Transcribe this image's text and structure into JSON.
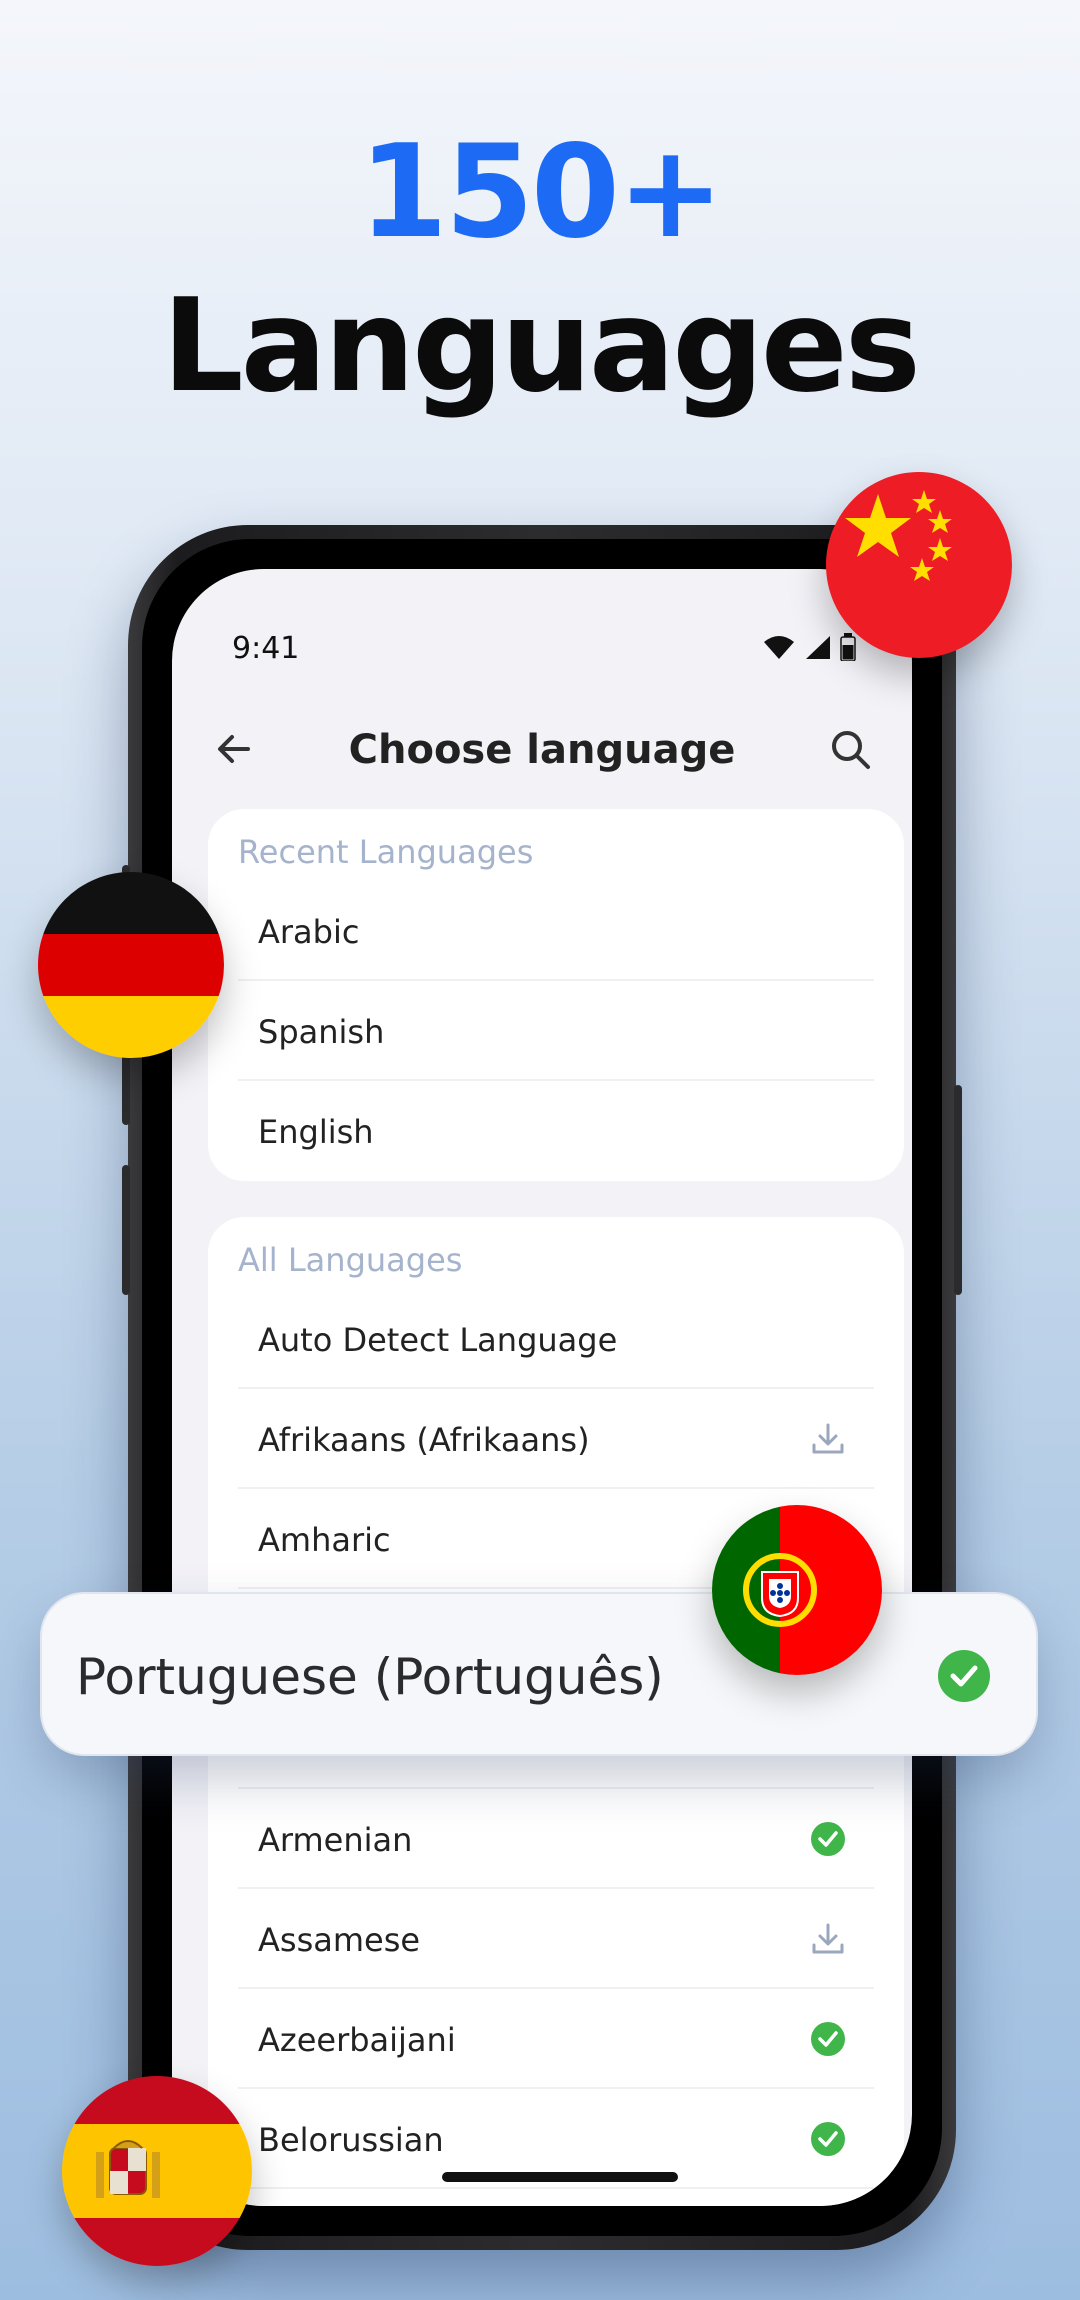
{
  "hero": {
    "count": "150+",
    "word": "Languages"
  },
  "status": {
    "time": "9:41"
  },
  "nav": {
    "title": "Choose language"
  },
  "recent": {
    "label": "Recent Languages",
    "items": [
      {
        "label": "Arabic"
      },
      {
        "label": "Spanish"
      },
      {
        "label": "English"
      }
    ]
  },
  "all": {
    "label": "All Languages",
    "items": [
      {
        "label": "Auto Detect Language",
        "icon": "none"
      },
      {
        "label": "Afrikaans (Afrikaans)",
        "icon": "download-icon"
      },
      {
        "label": "Amharic",
        "icon": "check-icon"
      },
      {
        "label": "Armenian",
        "icon": "check-icon"
      },
      {
        "label": "Assamese",
        "icon": "download-icon"
      },
      {
        "label": "Azeerbaijani",
        "icon": "check-icon"
      },
      {
        "label": "Belorussian",
        "icon": "check-icon"
      }
    ]
  },
  "popup": {
    "label": "Portuguese (Português)",
    "icon": "check-icon"
  },
  "colors": {
    "accent": "#1d6bf5",
    "check": "#3fb54a",
    "section": "#a5b4cc"
  },
  "flags": [
    "china-flag",
    "germany-flag",
    "portugal-flag",
    "spain-flag"
  ]
}
